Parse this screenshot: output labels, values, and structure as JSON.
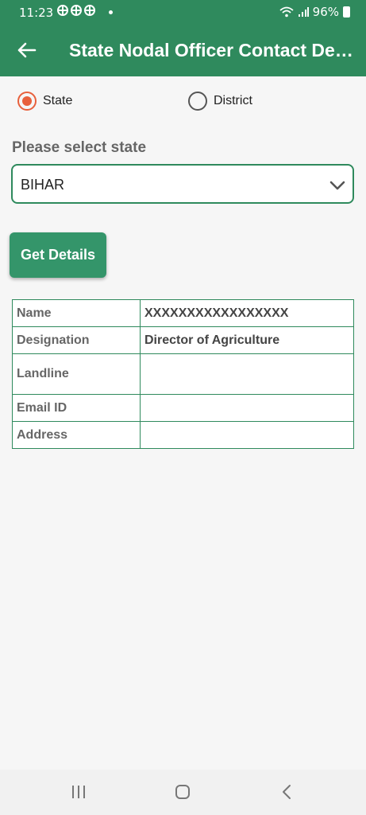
{
  "status_bar": {
    "time": "11:23",
    "battery": "96%"
  },
  "app_bar": {
    "title": "State Nodal Officer Contact Det..."
  },
  "radio_options": {
    "state_label": "State",
    "district_label": "District",
    "selected": "State"
  },
  "state_select": {
    "label": "Please select state",
    "value": "BIHAR"
  },
  "get_details": {
    "label": "Get Details"
  },
  "details": [
    {
      "key": "Name",
      "value": "XXXXXXXXXXXXXXXXX"
    },
    {
      "key": "Designation",
      "value": "Director of Agriculture"
    },
    {
      "key": "Landline",
      "value": ""
    },
    {
      "key": "Email ID",
      "value": ""
    },
    {
      "key": "Address",
      "value": ""
    }
  ],
  "colors": {
    "primary": "#2f8a5d",
    "button": "#34956a",
    "radio_accent": "#e8603c"
  },
  "icons": [
    "back-arrow-icon",
    "chevron-down-icon",
    "wifi-icon",
    "signal-icon",
    "battery-icon",
    "nav-recent-icon",
    "nav-home-icon",
    "nav-back-icon"
  ]
}
